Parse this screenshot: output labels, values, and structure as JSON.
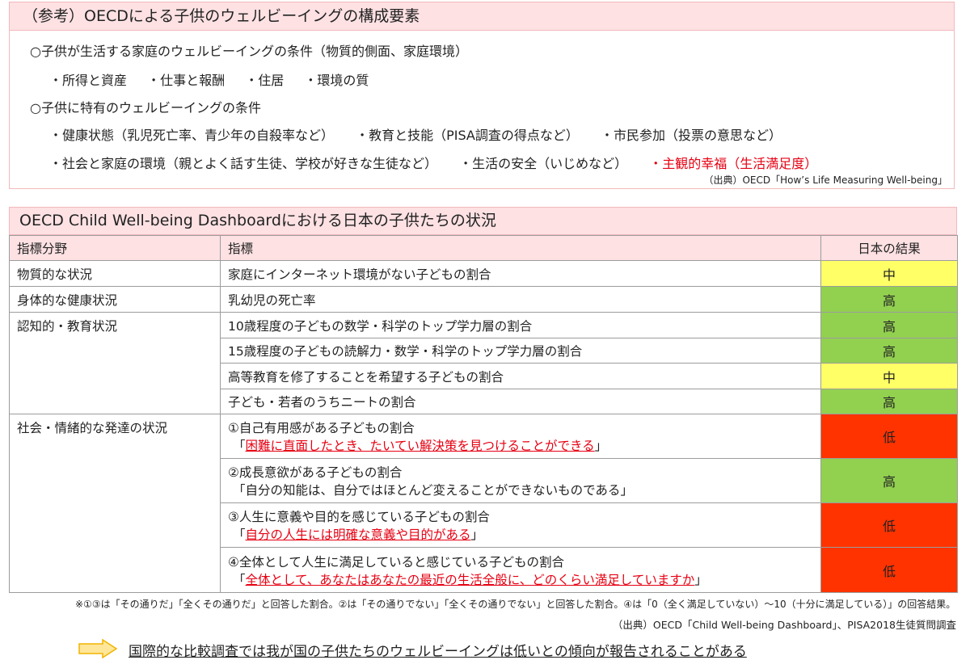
{
  "top": {
    "title": "（参考）OECDによる子供のウェルビーイングの構成要素",
    "cond1": "○子供が生活する家庭のウェルビーイングの条件（物質的側面、家庭環境）",
    "cond1_items": [
      "・所得と資産",
      "・仕事と報酬",
      "・住居",
      "・環境の質"
    ],
    "cond2": "○子供に特有のウェルビーイングの条件",
    "cond2_row1": [
      "・健康状態（乳児死亡率、青少年の自殺率など）",
      "・教育と技能（PISA調査の得点など）",
      "・市民参加（投票の意思など）"
    ],
    "cond2_row2": [
      "・社会と家庭の環境（親とよく話す生徒、学校が好きな生徒など）",
      "・生活の安全（いじめなど）",
      "・主観的幸福（生活満足度）"
    ],
    "source": "（出典）OECD「How’s Life Measuring Well-being」"
  },
  "dashboard": {
    "title": "OECD Child Well-being Dashboardにおける日本の子供たちの状況",
    "headers": {
      "category": "指標分野",
      "indicator": "指標",
      "result": "日本の結果"
    },
    "categories": [
      "物質的な状況",
      "身体的な健康状況",
      "認知的・教育状況",
      "社会・情緒的な発達の状況"
    ],
    "rows": [
      {
        "indicator": "家庭にインターネット環境がない子どもの割合",
        "result": "中"
      },
      {
        "indicator": "乳幼児の死亡率",
        "result": "高"
      },
      {
        "indicator": "10歳程度の子どもの数学・科学のトップ学力層の割合",
        "result": "高"
      },
      {
        "indicator": "15歳程度の子どもの読解力・数学・科学のトップ学力層の割合",
        "result": "高"
      },
      {
        "indicator": "高等教育を修了することを希望する子どもの割合",
        "result": "中"
      },
      {
        "indicator": "子ども・若者のうちニートの割合",
        "result": "高"
      },
      {
        "indicator": "①自己有用感がある子どもの割合",
        "quote_open": "「",
        "quote": "困難に直面したとき、たいてい解決策を見つけることができる",
        "quote_close": "」",
        "result": "低"
      },
      {
        "indicator": "②成長意欲がある子どもの割合",
        "quote_open": "「",
        "quote": "自分の知能は、自分ではほとんど変えることができないものである",
        "quote_close": "」",
        "result": "高"
      },
      {
        "indicator": "③人生に意義や目的を感じている子どもの割合",
        "quote_open": "「",
        "quote": "自分の人生には明確な意義や目的がある",
        "quote_close": "」",
        "result": "低"
      },
      {
        "indicator": "④全体として人生に満足していると感じている子どもの割合",
        "quote_open": "「",
        "quote": "全体として、あなたはあなたの最近の生活全般に、どのくらい満足していますか",
        "quote_close": "」",
        "result": "低"
      }
    ],
    "colors": {
      "high": "#92d050",
      "mid": "#ffff66",
      "low": "#ff3300"
    }
  },
  "footnote": "※①③は「その通りだ」「全くその通りだ」と回答した割合。②は「その通りでない」「全くその通りでない」と回答した割合。④は「0（全く満足していない）～10（十分に満足している）」の回答結果。",
  "source_bottom": "（出典）OECD「Child Well-being Dashboard」、PISA2018生徒質問調査",
  "conclusion": "国際的な比較調査では我が国の子供たちのウェルビーイングは低いとの傾向が報告されることがある"
}
